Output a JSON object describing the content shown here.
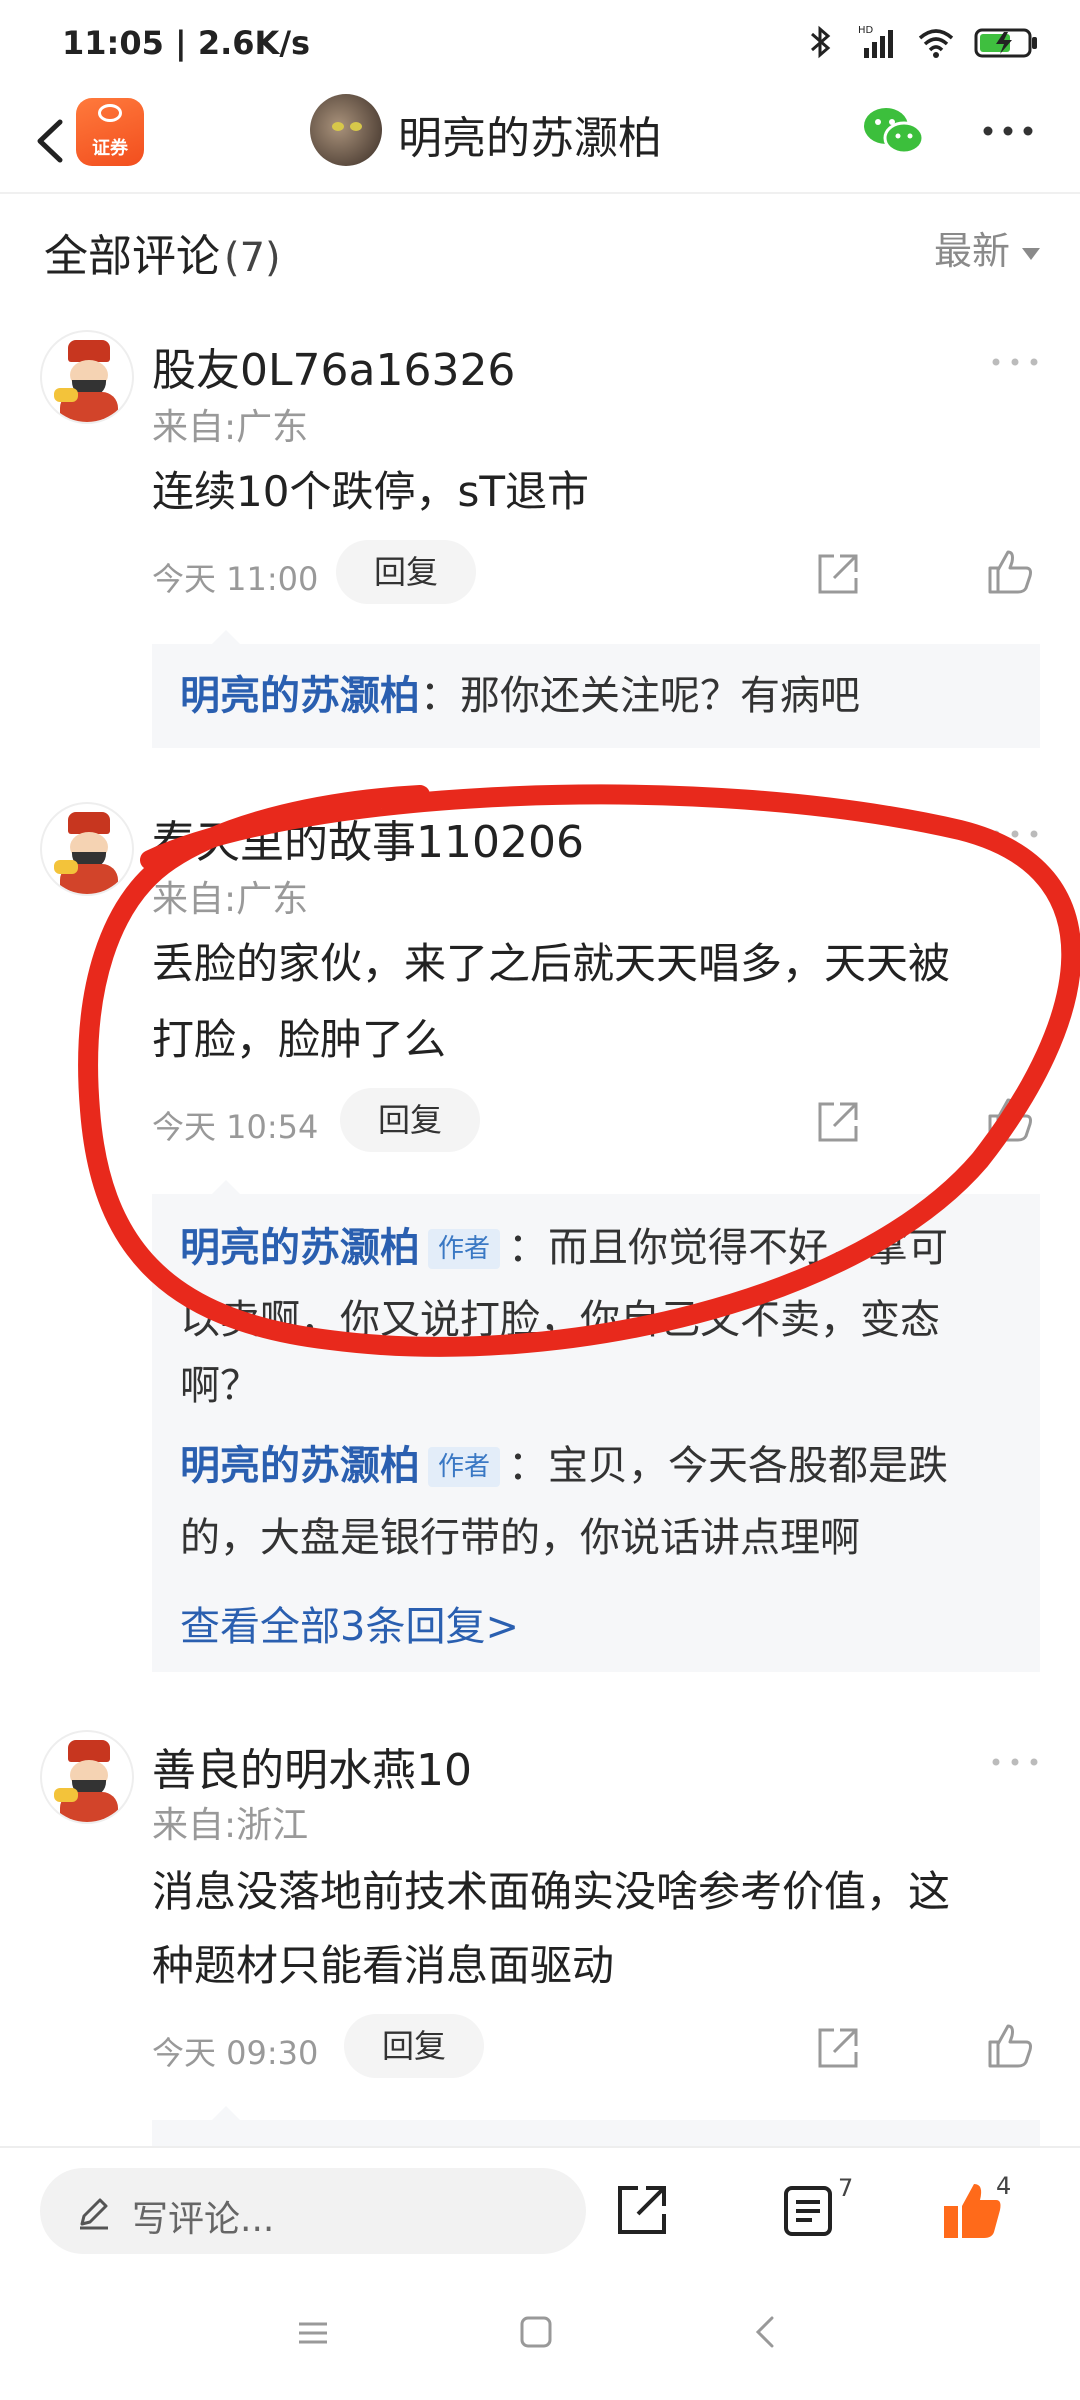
{
  "status": {
    "time_speed": "11:05 | 2.6K/s",
    "battery_color": "#3fbf3f"
  },
  "header": {
    "logo_label": "证券",
    "title": "明亮的苏灏柏"
  },
  "comments_header": {
    "title": "全部评论",
    "count": "(7)",
    "sort_label": "最新"
  },
  "comments": [
    {
      "name": "股友0L76a16326",
      "from": "来自:广东",
      "text": "连续10个跌停，sT退市",
      "time": "今天 11:00",
      "reply_label": "回复",
      "replies": [
        {
          "name": "明亮的苏灏柏",
          "badge": "",
          "text": "：那你还关注呢？有病吧"
        }
      ]
    },
    {
      "name": "春天里的故事110206",
      "from": "来自:广东",
      "text_line1": "丢脸的家伙，来了之后就天天唱多，天天被",
      "text_line2": "打脸，脸肿了么",
      "time": "今天 10:54",
      "reply_label": "回复",
      "replies": [
        {
          "name": "明亮的苏灏柏",
          "badge": "作者",
          "text": "：而且你觉得不好，拿可",
          "text2": "以卖啊，你又说打脸，你自己又不卖，变态",
          "text3": "啊？"
        },
        {
          "name": "明亮的苏灏柏",
          "badge": "作者",
          "text": "：宝贝，今天各股都是跌",
          "text2": "的，大盘是银行带的，你说话讲点理啊"
        }
      ],
      "view_all": "查看全部3条回复>"
    },
    {
      "name": "善良的明水燕10",
      "from": "来自:浙江",
      "text_line1": "消息没落地前技术面确实没啥参考价值，这",
      "text_line2": "种题材只能看消息面驱动",
      "time": "今天 09:30",
      "reply_label": "回复"
    }
  ],
  "bottom_bar": {
    "write_placeholder": "写评论...",
    "comment_count": "7",
    "like_count": "4",
    "like_color": "#ff6a1a"
  },
  "annotation_color": "#e8291c"
}
